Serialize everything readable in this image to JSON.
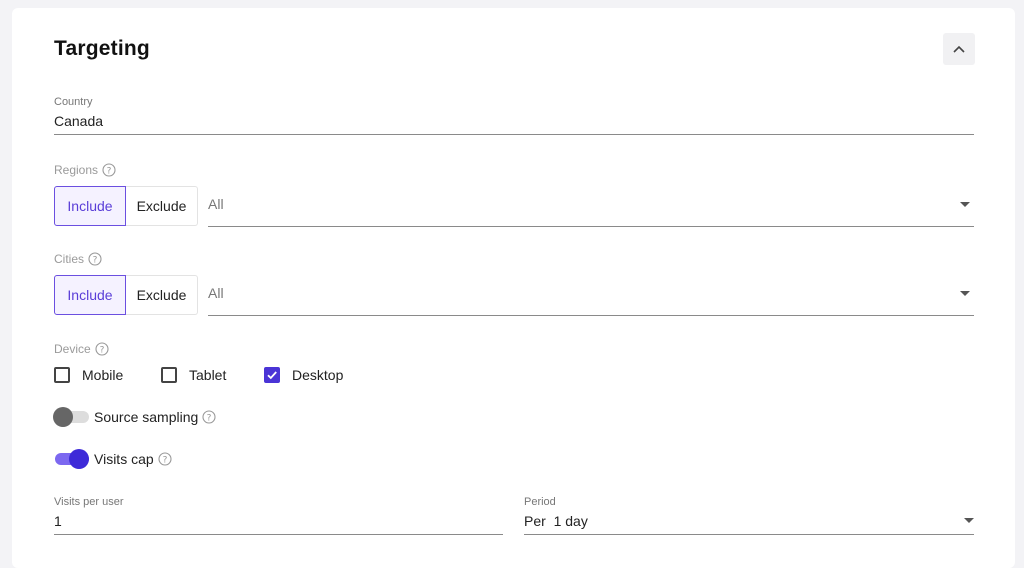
{
  "section": {
    "title": "Targeting",
    "collapse_icon": "chevron-up-icon"
  },
  "country": {
    "label": "Country",
    "value": "Canada"
  },
  "regions": {
    "label": "Regions",
    "include_label": "Include",
    "exclude_label": "Exclude",
    "selected": "All"
  },
  "cities": {
    "label": "Cities",
    "include_label": "Include",
    "exclude_label": "Exclude",
    "selected": "All"
  },
  "device": {
    "label": "Device",
    "options": [
      {
        "label": "Mobile",
        "checked": false
      },
      {
        "label": "Tablet",
        "checked": false
      },
      {
        "label": "Desktop",
        "checked": true
      }
    ]
  },
  "source_sampling": {
    "label": "Source sampling",
    "enabled": false
  },
  "visits_cap": {
    "label": "Visits cap",
    "enabled": true
  },
  "visits_per_user": {
    "label": "Visits per user",
    "value": "1"
  },
  "period": {
    "label": "Period",
    "value": "Per  1 day"
  },
  "colors": {
    "accent": "#5a3ed8",
    "checkbox_checked": "#4a34d6",
    "toggle_on": "#3d2ad8"
  }
}
